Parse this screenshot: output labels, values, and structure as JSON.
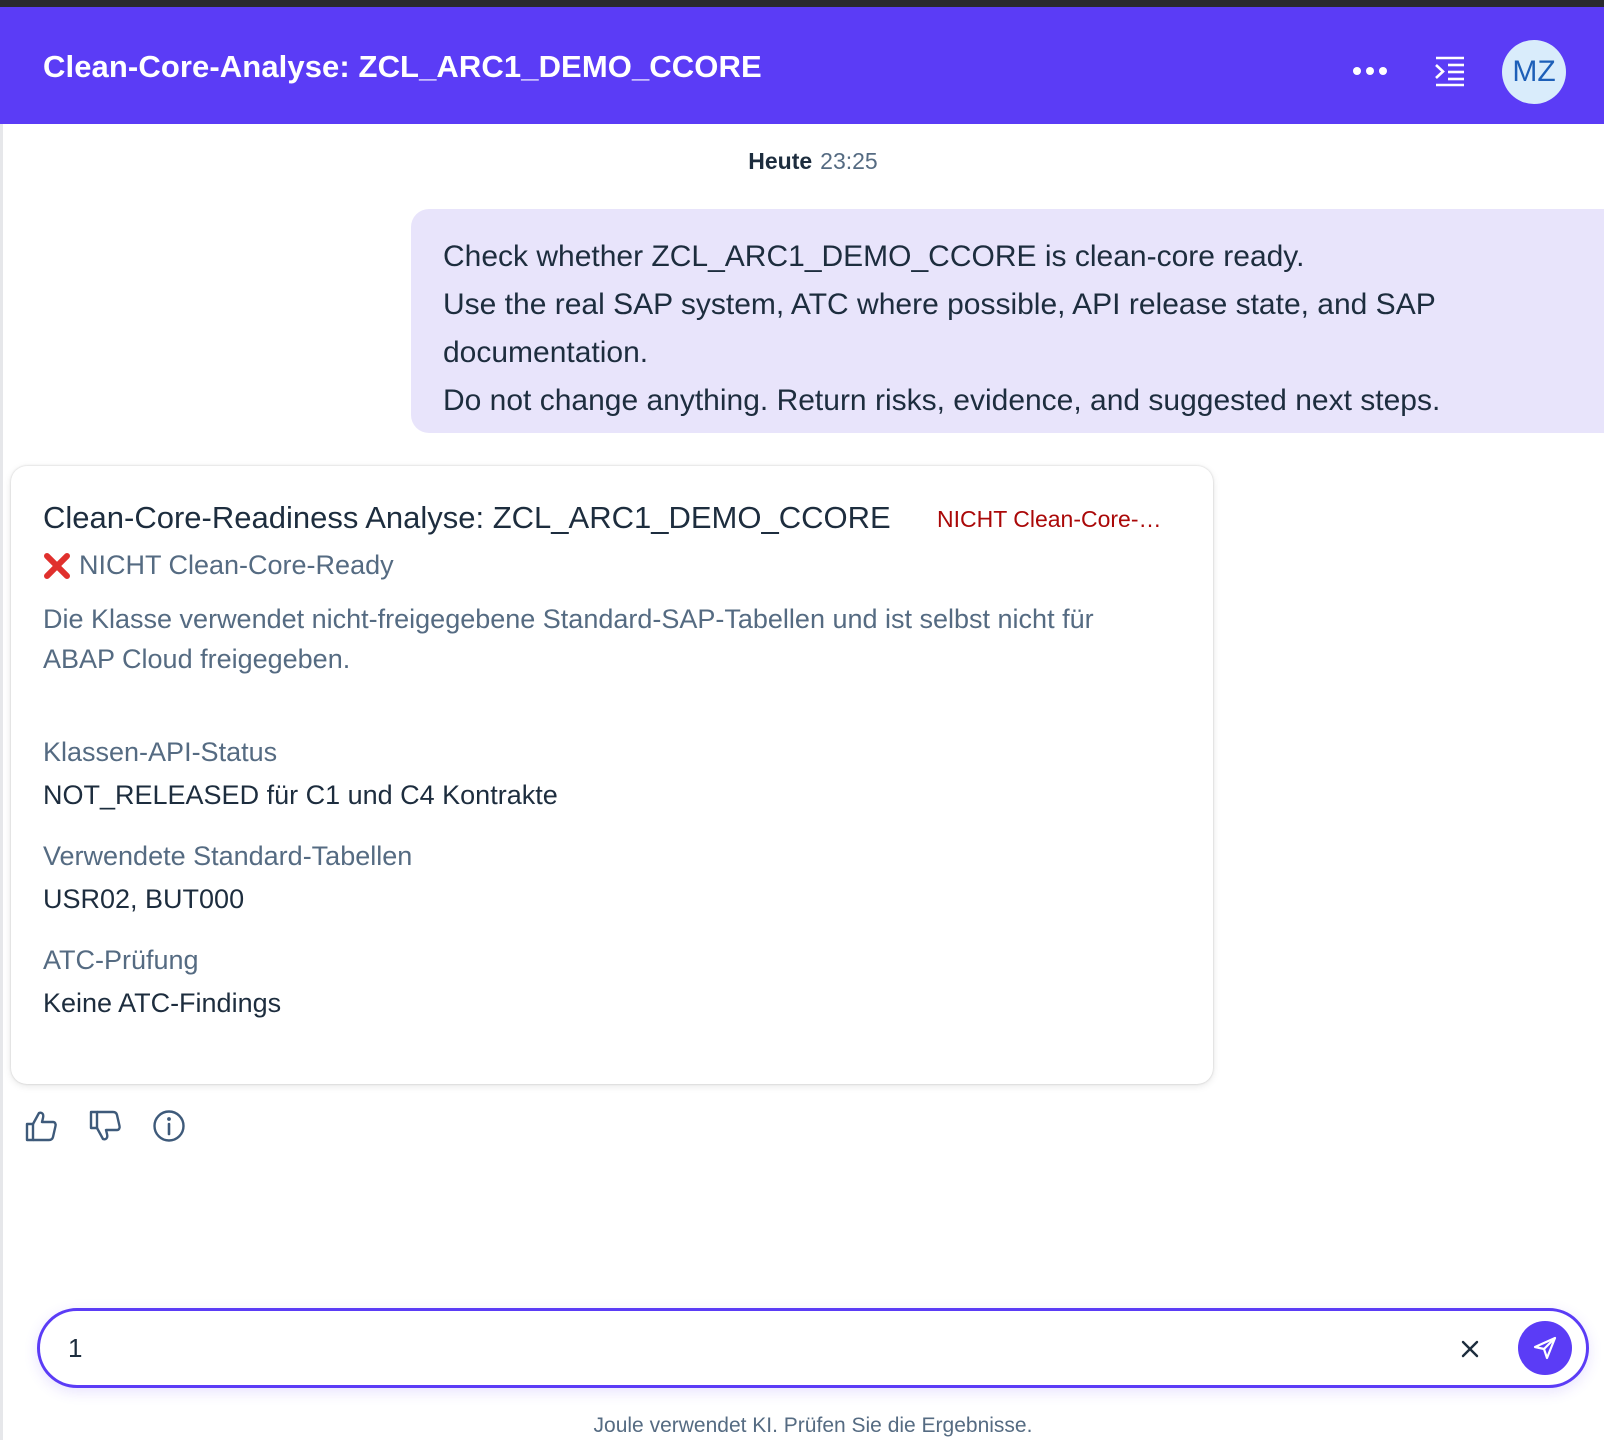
{
  "header": {
    "title": "Clean-Core-Analyse: ZCL_ARC1_DEMO_CCORE",
    "avatar_initials": "MZ",
    "more_icon": "more-horizontal-icon",
    "collapse_icon": "collapse-panel-icon"
  },
  "chat": {
    "timestamp_day": "Heute",
    "timestamp_time": "23:25",
    "user_message": [
      "Check whether ZCL_ARC1_DEMO_CCORE is clean-core ready.",
      "Use the real SAP system, ATC where possible, API release state, and SAP documentation.",
      "Do not change anything. Return risks, evidence, and suggested next steps."
    ]
  },
  "card": {
    "title": "Clean-Core-Readiness Analyse: ZCL_ARC1_DEMO_CCORE",
    "badge": "NICHT Clean-Core-Ready",
    "status": "NICHT Clean-Core-Ready",
    "description": "Die Klasse verwendet nicht-freigegebene Standard-SAP-Tabellen und ist selbst nicht für ABAP Cloud freigegeben.",
    "fields": [
      {
        "label": "Klassen-API-Status",
        "value": "NOT_RELEASED für C1 und C4 Kontrakte"
      },
      {
        "label": "Verwendete Standard-Tabellen",
        "value": "USR02, BUT000"
      },
      {
        "label": "ATC-Prüfung",
        "value": "Keine ATC-Findings"
      }
    ]
  },
  "feedback": {
    "like_icon": "thumbs-up-icon",
    "dislike_icon": "thumbs-down-icon",
    "info_icon": "info-icon"
  },
  "input": {
    "value": "1",
    "placeholder": ""
  },
  "footer": {
    "disclaimer": "Joule verwendet KI. Prüfen Sie die Ergebnisse."
  },
  "colors": {
    "accent": "#5b3cf6",
    "user_bubble": "#e8e4fb",
    "negative": "#aa0808",
    "secondary_text": "#556b82",
    "avatar_bg": "#d9ecfb"
  }
}
